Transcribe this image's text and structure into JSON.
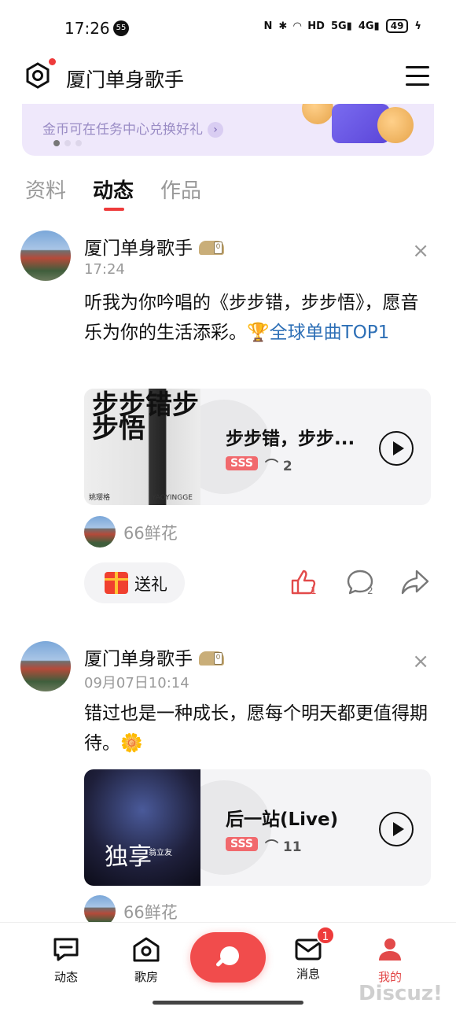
{
  "status_bar": {
    "time": "17:26",
    "notification_count": "55",
    "battery": "49",
    "icons": [
      "nfc-icon",
      "bluetooth-icon",
      "wifi-icon",
      "hd-icon",
      "5g-signal-icon",
      "4g-signal-icon",
      "battery-icon",
      "charging-icon"
    ]
  },
  "header": {
    "title": "厦门单身歌手"
  },
  "banner": {
    "subtitle": "金币可在任务中心兑换好礼"
  },
  "tabs": [
    {
      "label": "资料",
      "active": false
    },
    {
      "label": "动态",
      "active": true
    },
    {
      "label": "作品",
      "active": false
    }
  ],
  "posts": [
    {
      "author": "厦门单身歌手",
      "time": "17:24",
      "text": "听我为你吟唱的《步步错，步步悟》，愿音乐为你的生活添彩。",
      "rank_link": "全球单曲TOP1",
      "song": {
        "title": "步步错，步步...",
        "badge": "SSS",
        "plays": "2",
        "cover_text": "步步错步步悟",
        "cover_singer": "姚璎格",
        "cover_tag": "YAOYINGGE"
      },
      "flowers": "66鲜花",
      "gift_label": "送礼",
      "likes": "1",
      "comments": "2"
    },
    {
      "author": "厦门单身歌手",
      "time": "09月07日10:14",
      "text": "错过也是一种成长，愿每个明天都更值得期待。",
      "emoji": "🌼",
      "song": {
        "title": "后一站(Live)",
        "badge": "SSS",
        "plays": "11",
        "cover_text": "独享",
        "cover_singer": "翁立友"
      },
      "flowers": "66鲜花"
    }
  ],
  "bottom_nav": [
    {
      "label": "动态",
      "icon": "message-square-icon"
    },
    {
      "label": "歌房",
      "icon": "house-icon"
    },
    {
      "label": "",
      "icon": "microphone-icon"
    },
    {
      "label": "消息",
      "icon": "mail-icon",
      "badge": "1"
    },
    {
      "label": "我的",
      "icon": "person-icon",
      "active": true
    }
  ],
  "watermark": "Discuz!",
  "colors": {
    "accent": "#ee3b3b",
    "link": "#2d6fb6",
    "badge_sss": "#f1696d"
  }
}
